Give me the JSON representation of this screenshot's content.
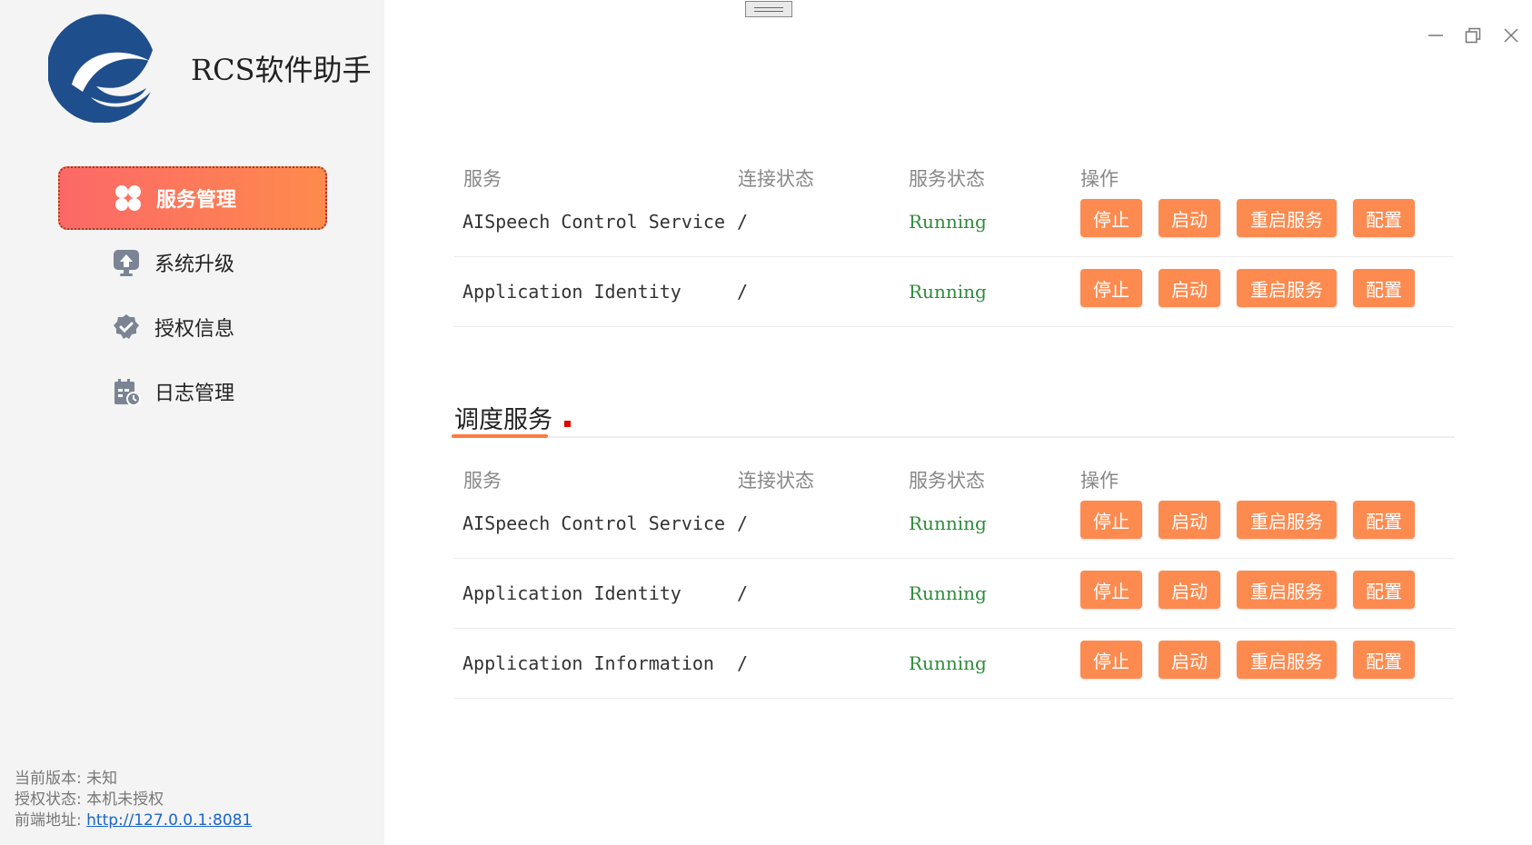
{
  "app": {
    "title": "RCS软件助手"
  },
  "sidebar": {
    "items": [
      {
        "label": "服务管理",
        "icon": "apps-icon",
        "active": true
      },
      {
        "label": "系统升级",
        "icon": "upload-icon",
        "active": false
      },
      {
        "label": "授权信息",
        "icon": "verified-badge-icon",
        "active": false
      },
      {
        "label": "日志管理",
        "icon": "log-calendar-icon",
        "active": false
      }
    ],
    "footer": {
      "version": "当前版本: 未知",
      "license": "授权状态: 本机未授权",
      "frontend_label": "前端地址: ",
      "frontend_url": "http://127.0.0.1:8081"
    }
  },
  "columns": {
    "service": "服务",
    "connection": "连接状态",
    "status": "服务状态",
    "actions": "操作"
  },
  "buttons": {
    "stop": "停止",
    "start": "启动",
    "restart": "重启服务",
    "config": "配置"
  },
  "section1": {
    "rows": [
      {
        "name": "AISpeech Control Service",
        "connection": "/",
        "status": "Running"
      },
      {
        "name": "Application Identity",
        "connection": "/",
        "status": "Running"
      }
    ]
  },
  "section2": {
    "title": "调度服务",
    "rows": [
      {
        "name": "AISpeech Control Service",
        "connection": "/",
        "status": "Running"
      },
      {
        "name": "Application Identity",
        "connection": "/",
        "status": "Running"
      },
      {
        "name": "Application Information",
        "connection": "/",
        "status": "Running"
      }
    ]
  },
  "colors": {
    "accent": "#fd8b50",
    "running": "#2e8b3a",
    "logo": "#1f4e8c"
  }
}
